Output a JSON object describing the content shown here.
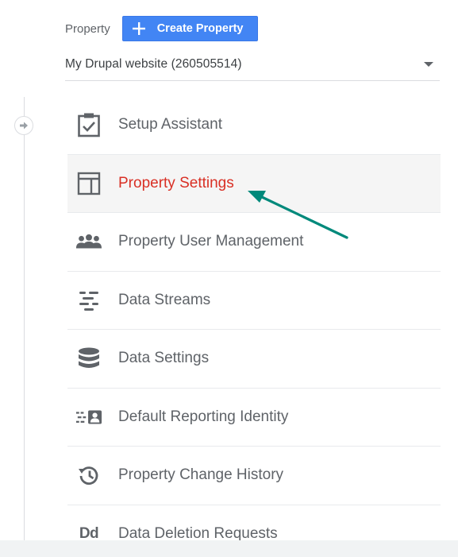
{
  "header": {
    "label": "Property",
    "create_button_label": "Create Property"
  },
  "property_selector": {
    "value": "My Drupal website (260505514)"
  },
  "menu": {
    "items": [
      {
        "label": "Setup Assistant",
        "icon": "clipboard-check-icon"
      },
      {
        "label": "Property Settings",
        "icon": "layout-icon",
        "active": true
      },
      {
        "label": "Property User Management",
        "icon": "people-icon"
      },
      {
        "label": "Data Streams",
        "icon": "streams-icon"
      },
      {
        "label": "Data Settings",
        "icon": "database-icon"
      },
      {
        "label": "Default Reporting Identity",
        "icon": "identity-icon"
      },
      {
        "label": "Property Change History",
        "icon": "history-icon"
      },
      {
        "label": "Data Deletion Requests",
        "icon": "dd-icon",
        "icon_text": "Dd"
      }
    ]
  },
  "colors": {
    "accent_button": "#4285f4",
    "active_text": "#d93025",
    "annotation_arrow": "#00897b"
  }
}
